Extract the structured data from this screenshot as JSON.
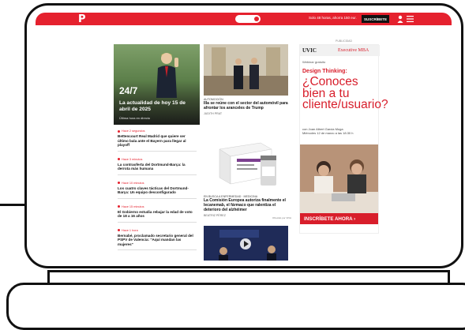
{
  "header": {
    "logo": "P",
    "promo": "Solo 48 horas, ahorra 150 eur.",
    "subscribe_label": "SUSCRÍBETE"
  },
  "hero": {
    "live": "24/7",
    "title": "La actualidad de hoy 15 de abril de 2025",
    "subtitle": "Última hora en directo"
  },
  "left_news": [
    {
      "time": "Hace 2 segundos",
      "headline": "Bettencourt Real Madrid que quiere ser último bala ante el Bayern para llegar al playoff"
    },
    {
      "time": "Hace 3 minutos",
      "headline": "La contraoferta del Dortmund-Barça: la derrota más humana"
    },
    {
      "time": "Hace 10 minutos",
      "headline": "Los cuatro claves tácticas del Dortmund-Barça: Un equipo desconfigurado"
    },
    {
      "time": "Hace 15 minutos",
      "headline": "El Gobierno estudia rebajar la edad de voto de 18 a 16 años"
    },
    {
      "time": "Hace 1 hora",
      "headline": "Bernabé, proclamado secretario general del PSPV de Valencia: \"Aquí mandan las mujeres\""
    }
  ],
  "middle": {
    "story1": {
      "category": "AUTOMOCIÓN",
      "headline": "Illa se reúne con el sector del automóvil para afrontar los aranceles de Trump",
      "author": "JUDITH PRAT"
    },
    "story2": {
      "category": "EN BUSCA A ENFERMEDAD · MEDICINA",
      "headline": "La Comisión Europea autoriza finalmente el lecanemab, el fármaco que ralentiza el deterioro del alzhéimer",
      "author": "BEATRIZ PÉREZ"
    },
    "sponsored": "Ofrecido por VIVA"
  },
  "ad": {
    "label": "PUBLICIDAD",
    "brand": "UVIC",
    "program": "Executive MBA",
    "webinar": "Webinar gratuito",
    "topic": "Design Thinking:",
    "question": "¿Conoces bien a tu cliente/usuario?",
    "speaker": "con Joan Albert Garcia Moga",
    "date": "Miércoles 12 de marzo a las 18:30 h",
    "cta": "INSCRÍBETE AHORA ›",
    "accent": "#d81e2b"
  },
  "colors": {
    "brand_red": "#e5212e"
  }
}
